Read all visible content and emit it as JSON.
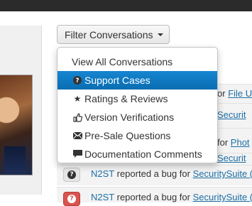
{
  "filter": {
    "label": "Filter Conversations"
  },
  "menu": {
    "items": [
      {
        "label": "View All Conversations",
        "icon": "",
        "active": false
      },
      {
        "label": "Support Cases",
        "icon": "question-circle-icon",
        "active": true
      },
      {
        "label": "Ratings & Reviews",
        "icon": "star-icon",
        "active": false
      },
      {
        "label": "Version Verifications",
        "icon": "thumbs-up-icon",
        "active": false
      },
      {
        "label": "Pre-Sale Questions",
        "icon": "envelope-icon",
        "active": false
      },
      {
        "label": "Documentation Comments",
        "icon": "comment-icon",
        "active": false
      }
    ]
  },
  "list": {
    "peek_rows": [
      {
        "prefix": "or",
        "link": "File U"
      },
      {
        "prefix": "",
        "link": "Securit"
      },
      {
        "prefix": "for",
        "link": "Phot"
      },
      {
        "prefix": "",
        "link": "Securit"
      }
    ],
    "rows": [
      {
        "user": "N2ST",
        "action": "reported a bug for",
        "link": "SecuritySuite (",
        "badge": "grey"
      },
      {
        "user": "N2ST",
        "action": "reported a bug for",
        "link": "SecuritySuite (",
        "badge": "red"
      }
    ]
  },
  "colors": {
    "accent": "#0a6db2",
    "link": "#1d6fa5",
    "danger": "#d9534f"
  }
}
